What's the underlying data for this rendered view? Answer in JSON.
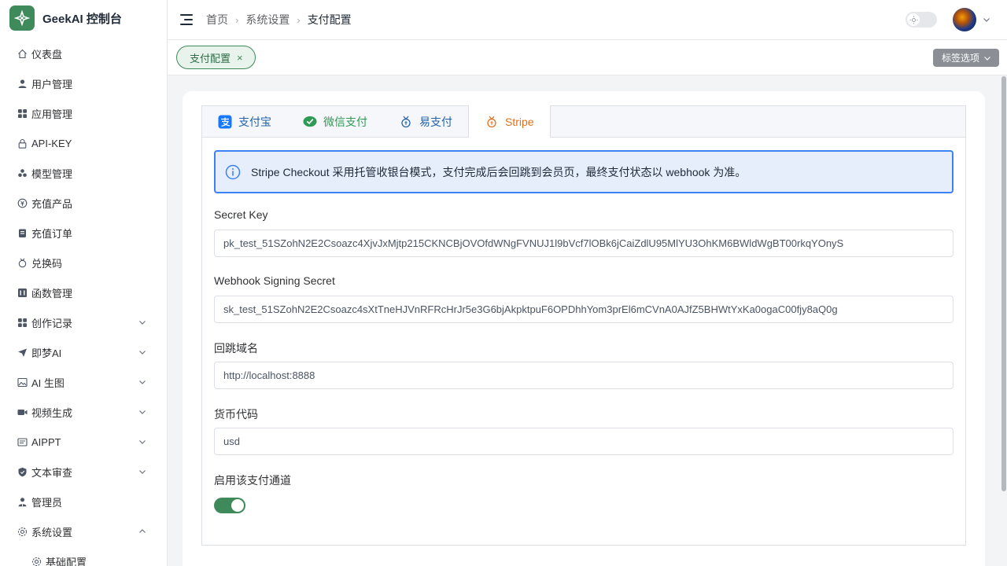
{
  "brand": {
    "title": "GeekAI 控制台"
  },
  "sidebar": {
    "items": [
      {
        "label": "仪表盘",
        "icon": "house-icon"
      },
      {
        "label": "用户管理",
        "icon": "user-icon"
      },
      {
        "label": "应用管理",
        "icon": "grid-icon"
      },
      {
        "label": "API-KEY",
        "icon": "lock-icon"
      },
      {
        "label": "模型管理",
        "icon": "cube-icon"
      },
      {
        "label": "充值产品",
        "icon": "coin-icon"
      },
      {
        "label": "充值订单",
        "icon": "order-icon"
      },
      {
        "label": "兑换码",
        "icon": "medal-icon"
      },
      {
        "label": "函数管理",
        "icon": "function-icon"
      },
      {
        "label": "创作记录",
        "icon": "grid-icon",
        "expandable": true
      },
      {
        "label": "即梦AI",
        "icon": "paper-plane-icon",
        "expandable": true
      },
      {
        "label": "AI 生图",
        "icon": "picture-icon",
        "expandable": true
      },
      {
        "label": "视频生成",
        "icon": "video-icon",
        "expandable": true
      },
      {
        "label": "AIPPT",
        "icon": "slides-icon",
        "expandable": true
      },
      {
        "label": "文本审查",
        "icon": "shield-icon",
        "expandable": true
      },
      {
        "label": "管理员",
        "icon": "admin-icon"
      },
      {
        "label": "系统设置",
        "icon": "gear-icon",
        "expandable": true,
        "expanded": true
      }
    ],
    "sub_items": [
      {
        "label": "基础配置",
        "icon": "gear-icon"
      }
    ]
  },
  "header": {
    "breadcrumb": [
      "首页",
      "系统设置",
      "支付配置"
    ]
  },
  "tagbar": {
    "active_tag": "支付配置",
    "close_glyph": "×",
    "options_label": "标签选项"
  },
  "tabs": [
    {
      "label": "支付宝",
      "icon": "alipay-icon"
    },
    {
      "label": "微信支付",
      "icon": "wechat-icon"
    },
    {
      "label": "易支付",
      "icon": "medal-icon"
    },
    {
      "label": "Stripe",
      "icon": "medal-icon",
      "active": true
    }
  ],
  "alert": {
    "text": "Stripe Checkout 采用托管收银台模式，支付完成后会回跳到会员页，最终支付状态以 webhook 为准。"
  },
  "form": {
    "secret_key": {
      "label": "Secret Key",
      "value": "pk_test_51SZohN2E2Csoazc4XjvJxMjtp215CKNCBjOVOfdWNgFVNUJ1l9bVcf7lOBk6jCaiZdlU95MlYU3OhKM6BWldWgBT00rkqYOnyS"
    },
    "webhook_secret": {
      "label": "Webhook Signing Secret",
      "value": "sk_test_51SZohN2E2Csoazc4sXtTneHJVnRFRcHrJr5e3G6bjAkpktpuF6OPDhhYom3prEl6mCVnA0AJfZ5BHWtYxKa0ogaC00fjy8aQ0g"
    },
    "callback_domain": {
      "label": "回跳域名",
      "value": "http://localhost:8888"
    },
    "currency": {
      "label": "货币代码",
      "value": "usd"
    },
    "enabled": {
      "label": "启用该支付通道",
      "value": true
    }
  },
  "colors": {
    "accent": "#3f8a5a",
    "active_tab": "#e0701b",
    "alert_border": "#3b82f6",
    "alert_bg": "#e6eefc"
  }
}
